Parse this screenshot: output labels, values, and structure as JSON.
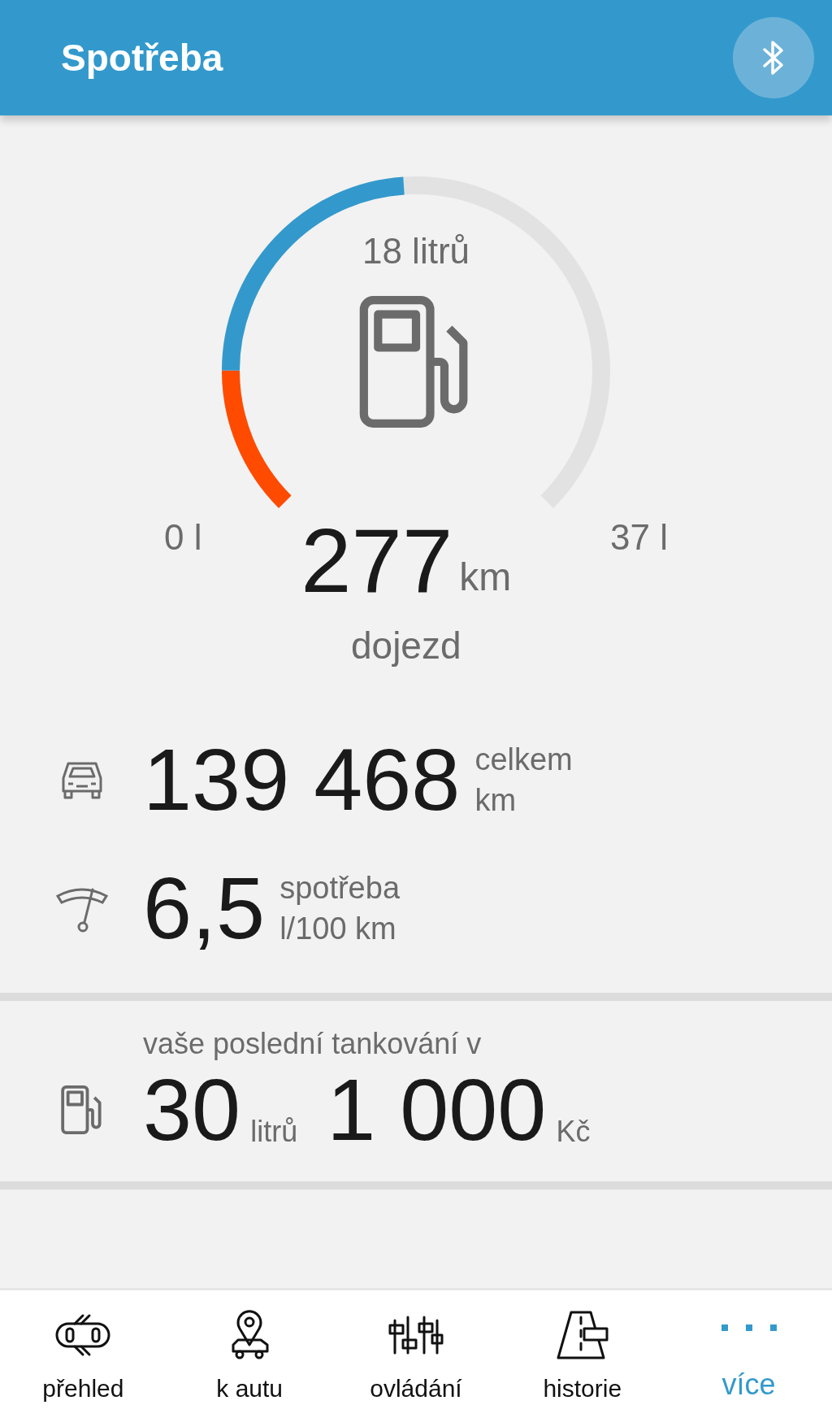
{
  "header": {
    "title": "Spotřeba"
  },
  "gauge": {
    "amount": "18 litrů",
    "min_label": "0 l",
    "max_label": "37 l",
    "segments": [
      {
        "color": "#ff4b00"
      },
      {
        "color": "#3399cc"
      }
    ]
  },
  "range": {
    "value": "277",
    "unit": "km",
    "label": "dojezd"
  },
  "stats": [
    {
      "kind": "odometer",
      "value": "139 468",
      "label": "celkem",
      "unit": "km"
    },
    {
      "kind": "consumption",
      "value": "6,5",
      "label": "spotřeba",
      "unit": "l/100 km"
    }
  ],
  "last_refuel": {
    "caption": "vaše poslední tankování v",
    "liters": "30",
    "liters_unit": "litrů",
    "price": "1 000",
    "price_unit": "Kč"
  },
  "nav": [
    {
      "kind": "overview",
      "label": "přehled",
      "selected": false
    },
    {
      "kind": "to_car",
      "label": "k autu",
      "selected": false
    },
    {
      "kind": "controls",
      "label": "ovládání",
      "selected": false
    },
    {
      "kind": "history",
      "label": "historie",
      "selected": false
    },
    {
      "kind": "more",
      "label": "více",
      "selected": true
    }
  ]
}
